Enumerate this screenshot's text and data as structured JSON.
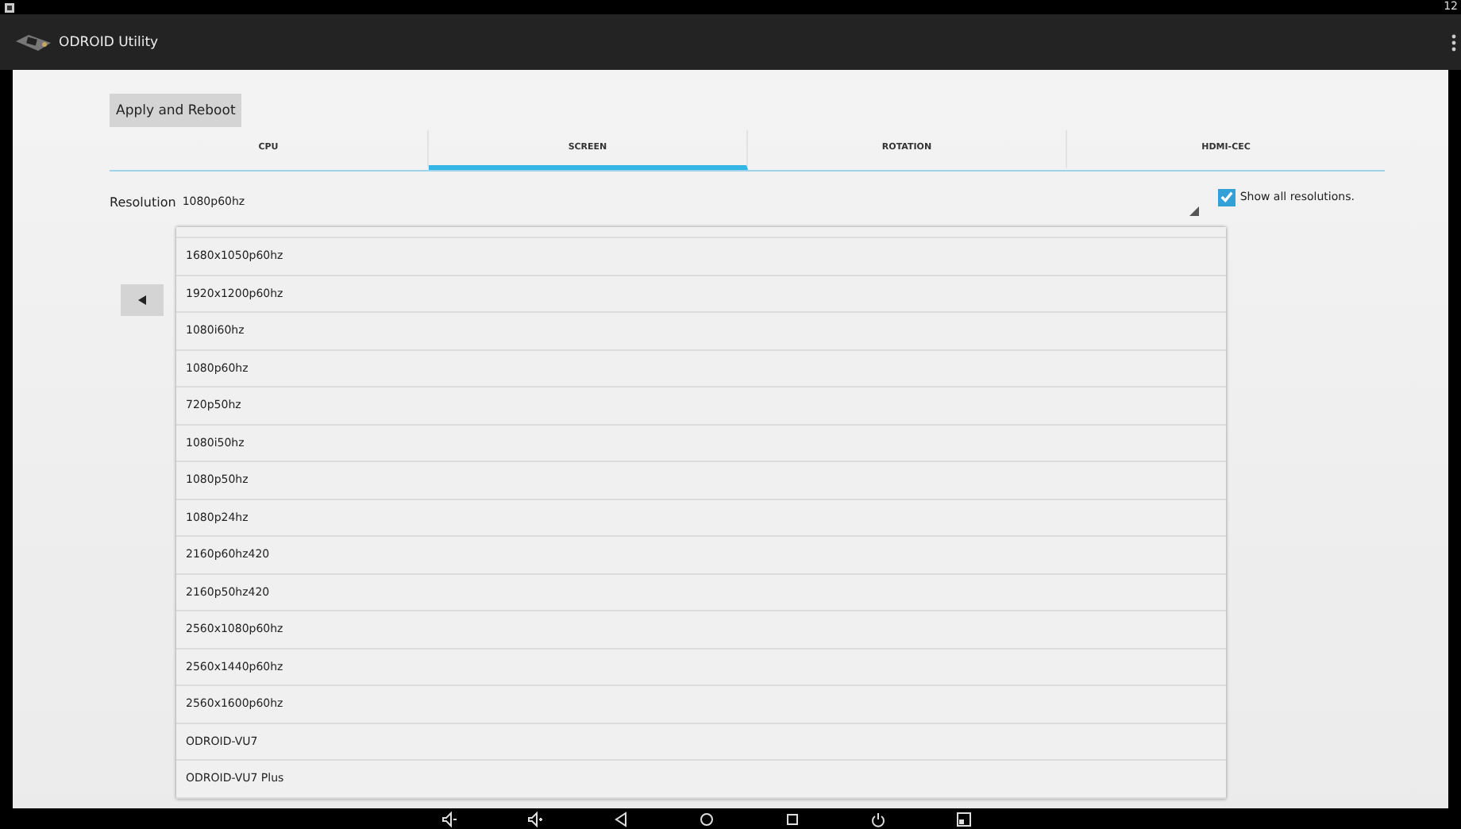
{
  "status_bar": {
    "time": "12"
  },
  "app_bar": {
    "title": "ODROID Utility"
  },
  "apply_button": "Apply and Reboot",
  "tabs": [
    {
      "label": "CPU",
      "selected": false
    },
    {
      "label": "SCREEN",
      "selected": true
    },
    {
      "label": "ROTATION",
      "selected": false
    },
    {
      "label": "HDMI-CEC",
      "selected": false
    }
  ],
  "resolution": {
    "label": "Resolution",
    "value": "1080p60hz"
  },
  "show_all": {
    "label": "Show all resolutions.",
    "checked": true
  },
  "dropdown": {
    "options": [
      "1680x1050p60hz",
      "1920x1200p60hz",
      "1080i60hz",
      "1080p60hz",
      "720p50hz",
      "1080i50hz",
      "1080p50hz",
      "1080p24hz",
      "2160p60hz420",
      "2160p50hz420",
      "2560x1080p60hz",
      "2560x1440p60hz",
      "2560x1600p60hz",
      "ODROID-VU7",
      "ODROID-VU7 Plus"
    ]
  },
  "nav_bar": {
    "buttons": [
      {
        "kind": "volume-down"
      },
      {
        "kind": "volume-up"
      },
      {
        "kind": "back"
      },
      {
        "kind": "home"
      },
      {
        "kind": "recents"
      },
      {
        "kind": "power"
      },
      {
        "kind": "screenshot"
      }
    ]
  }
}
